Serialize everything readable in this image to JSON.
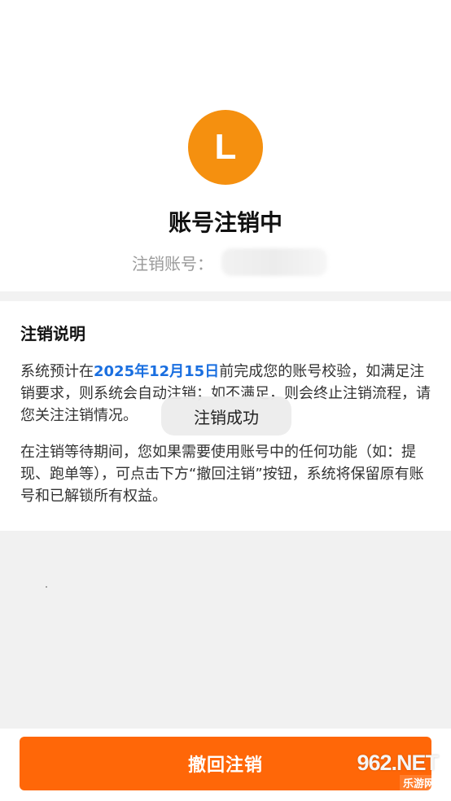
{
  "profile": {
    "avatar_letter": "L",
    "title": "账号注销中",
    "account_label": "注销账号："
  },
  "info": {
    "heading": "注销说明",
    "paragraph_1_before": "系统预计在",
    "paragraph_1_date": "2025年12月15日",
    "paragraph_1_after": "前完成您的账号校验，如满足注销要求，则系统会自动注销；如不满足，则会终止注销流程，请您关注注销情况。",
    "paragraph_2": "在注销等待期间，您如果需要使用账号中的任何功能（如：提现、跑单等），可点击下方“撤回注销”按钮，系统将保留原有账号和已解锁所有权益。"
  },
  "toast": {
    "message": "注销成功"
  },
  "footer": {
    "button_label": "撤回注销"
  },
  "watermark": {
    "main": "962.NET",
    "sub": "乐游网"
  },
  "colors": {
    "avatar": "#f5900f",
    "primary_button": "#ff6708",
    "highlight": "#1a6fe0",
    "band": "#f2f2f2"
  }
}
